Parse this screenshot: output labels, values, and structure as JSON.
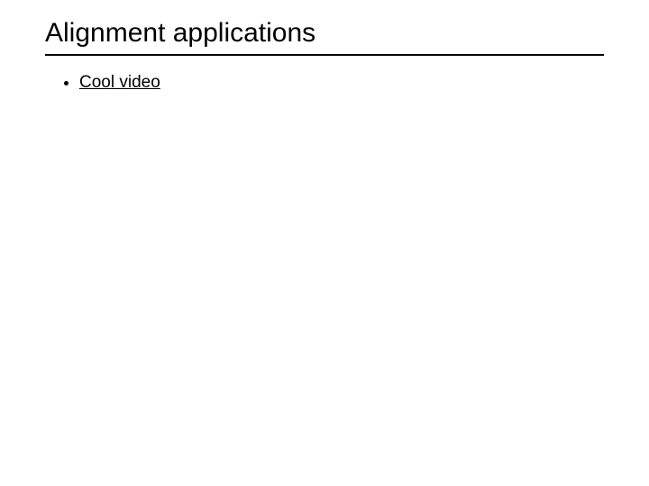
{
  "slide": {
    "title": "Alignment applications",
    "bullets": [
      {
        "text": "Cool video",
        "is_link": true
      }
    ]
  }
}
